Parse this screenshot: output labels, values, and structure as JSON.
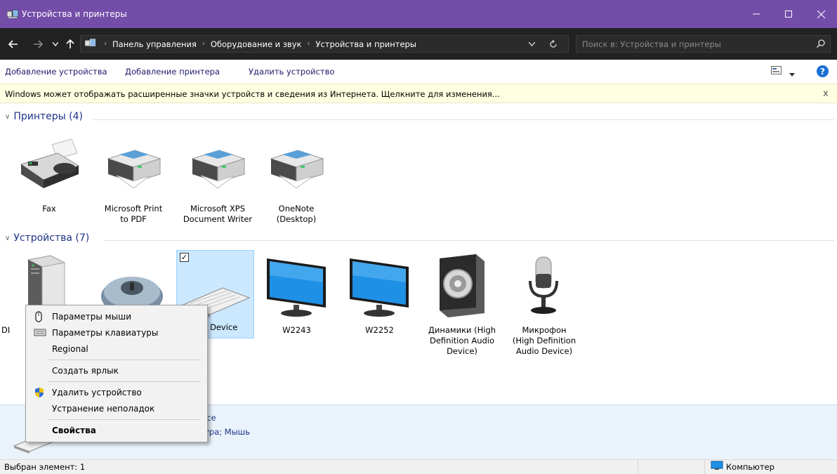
{
  "window": {
    "title": "Устройства и принтеры"
  },
  "address": {
    "crumbs": [
      "Панель управления",
      "Оборудование и звук",
      "Устройства и принтеры"
    ],
    "search_placeholder": "Поиск в: Устройства и принтеры"
  },
  "commands": {
    "add_device": "Добавление устройства",
    "add_printer": "Добавление принтера",
    "remove_device": "Удалить устройство"
  },
  "infobar": {
    "text": "Windows может отображать расширенные значки устройств и сведения из Интернета.  Щелкните для изменения...",
    "close": "x"
  },
  "printers": {
    "header": "Принтеры (4)",
    "items": [
      {
        "l1": "Fax",
        "l2": ""
      },
      {
        "l1": "Microsoft Print",
        "l2": "to PDF"
      },
      {
        "l1": "Microsoft XPS",
        "l2": "Document Writer"
      },
      {
        "l1": "OneNote",
        "l2": "(Desktop)"
      }
    ]
  },
  "devices": {
    "header": "Устройства (7)",
    "items": [
      {
        "l1": "DI"
      },
      {
        "l1": ""
      },
      {
        "l1": "Device"
      },
      {
        "l1": "W2243"
      },
      {
        "l1": "W2252"
      },
      {
        "l1": "Динамики (High",
        "l2": "Definition Audio",
        "l3": "Device)"
      },
      {
        "l1": "Микрофон",
        "l2": "(High Definition",
        "l3": "Audio Device)"
      }
    ]
  },
  "details": {
    "name": "ice",
    "category": "ура; Мышь"
  },
  "context_menu": {
    "mouse": "Параметры мыши",
    "keyboard": "Параметры клавиатуры",
    "regional": "Regional",
    "shortcut": "Создать ярлык",
    "remove": "Удалить устройство",
    "troubleshoot": "Устранение неполадок",
    "properties": "Свойства"
  },
  "status": {
    "selected": "Выбран элемент: 1",
    "computer": "Компьютер"
  },
  "colors": {
    "titlebar": "#744da9",
    "addrbar": "#222222",
    "link": "#1e3287",
    "selection": "#cce8ff"
  }
}
